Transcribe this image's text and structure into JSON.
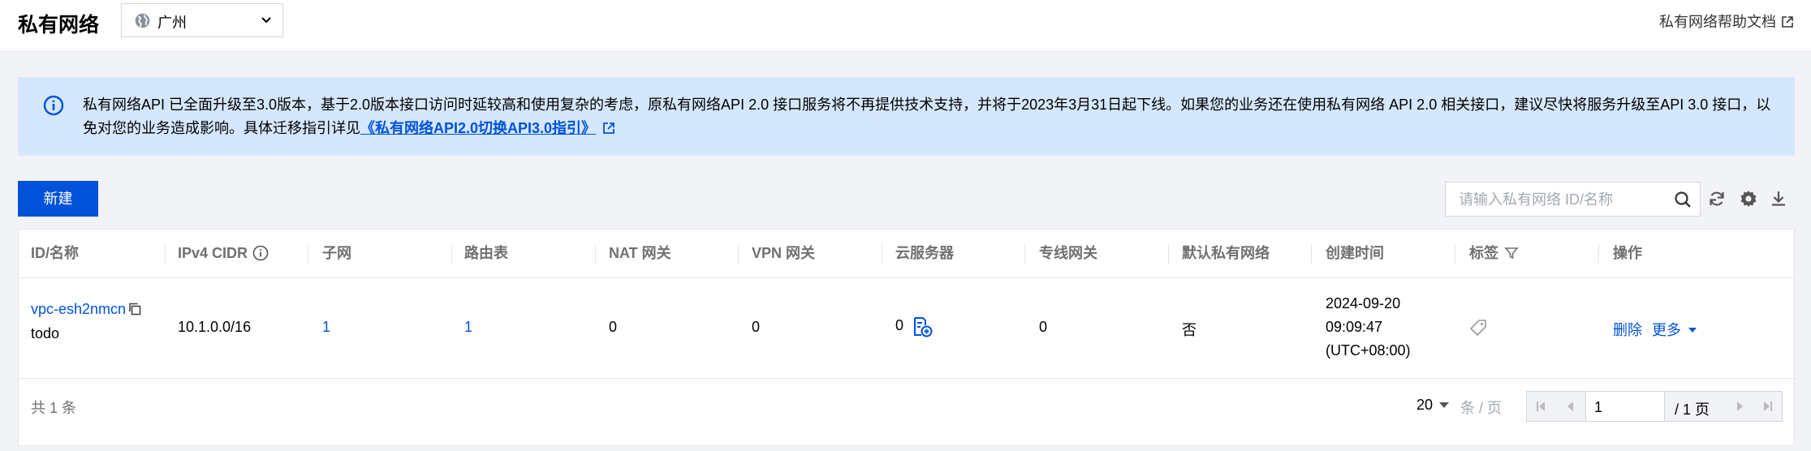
{
  "header": {
    "title": "私有网络",
    "region": "广州",
    "help_link": "私有网络帮助文档"
  },
  "notice": {
    "text": "私有网络API 已全面升级至3.0版本，基于2.0版本接口访问时延较高和使用复杂的考虑，原私有网络API 2.0 接口服务将不再提供技术支持，并将于2023年3月31日起下线。如果您的业务还在使用私有网络 API 2.0 相关接口，建议尽快将服务升级至API 3.0 接口，以免对您的业务造成影响。具体迁移指引详见",
    "link_text": "《私有网络API2.0切换API3.0指引》"
  },
  "toolbar": {
    "new_label": "新建",
    "search_placeholder": "请输入私有网络 ID/名称"
  },
  "table": {
    "columns": [
      "ID/名称",
      "IPv4 CIDR",
      "子网",
      "路由表",
      "NAT 网关",
      "VPN 网关",
      "云服务器",
      "专线网关",
      "默认私有网络",
      "创建时间",
      "标签",
      "操作"
    ],
    "rows": [
      {
        "id": "vpc-esh2nmcn",
        "name": "todo",
        "cidr": "10.1.0.0/16",
        "subnets": "1",
        "route_tables": "1",
        "nat": "0",
        "vpn": "0",
        "cvm": "0",
        "dc_gateway": "0",
        "default_vpc": "否",
        "created_date": "2024-09-20",
        "created_time": "09:09:47",
        "created_tz": "(UTC+08:00)",
        "action_delete": "删除",
        "action_more": "更多"
      }
    ]
  },
  "footer": {
    "total": "共 1 条",
    "page_size": "20",
    "per_page": "条 / 页",
    "page": "1",
    "total_pages": "/ 1 页"
  },
  "colors": {
    "primary": "#0052d9",
    "notice_bg": "#d5e7fd"
  }
}
